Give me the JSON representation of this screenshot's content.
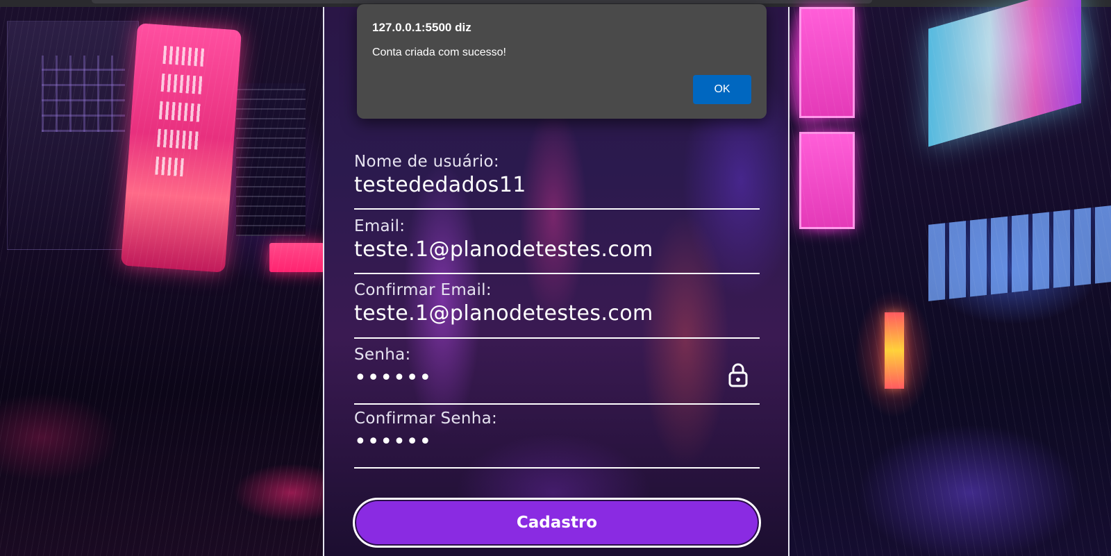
{
  "dialog": {
    "origin": "127.0.0.1:5500 diz",
    "message": "Conta criada com sucesso!",
    "ok_label": "OK"
  },
  "form": {
    "username": {
      "label": "Nome de usuário:",
      "value": "testededados11"
    },
    "email": {
      "label": "Email:",
      "value": "teste.1@planodetestes.com"
    },
    "confirm_email": {
      "label": "Confirmar Email:",
      "value": "teste.1@planodetestes.com"
    },
    "password": {
      "label": "Senha:",
      "value": "••••••"
    },
    "confirm_password": {
      "label": "Confirmar Senha:",
      "value": "••••••"
    },
    "submit_label": "Cadastro"
  },
  "icons": {
    "password_toggle": "lock-icon"
  },
  "colors": {
    "button_bg": "#8a2be2",
    "dialog_bg": "#4a4a4a",
    "dialog_ok_bg": "#0067c0",
    "text": "#ffffff"
  }
}
